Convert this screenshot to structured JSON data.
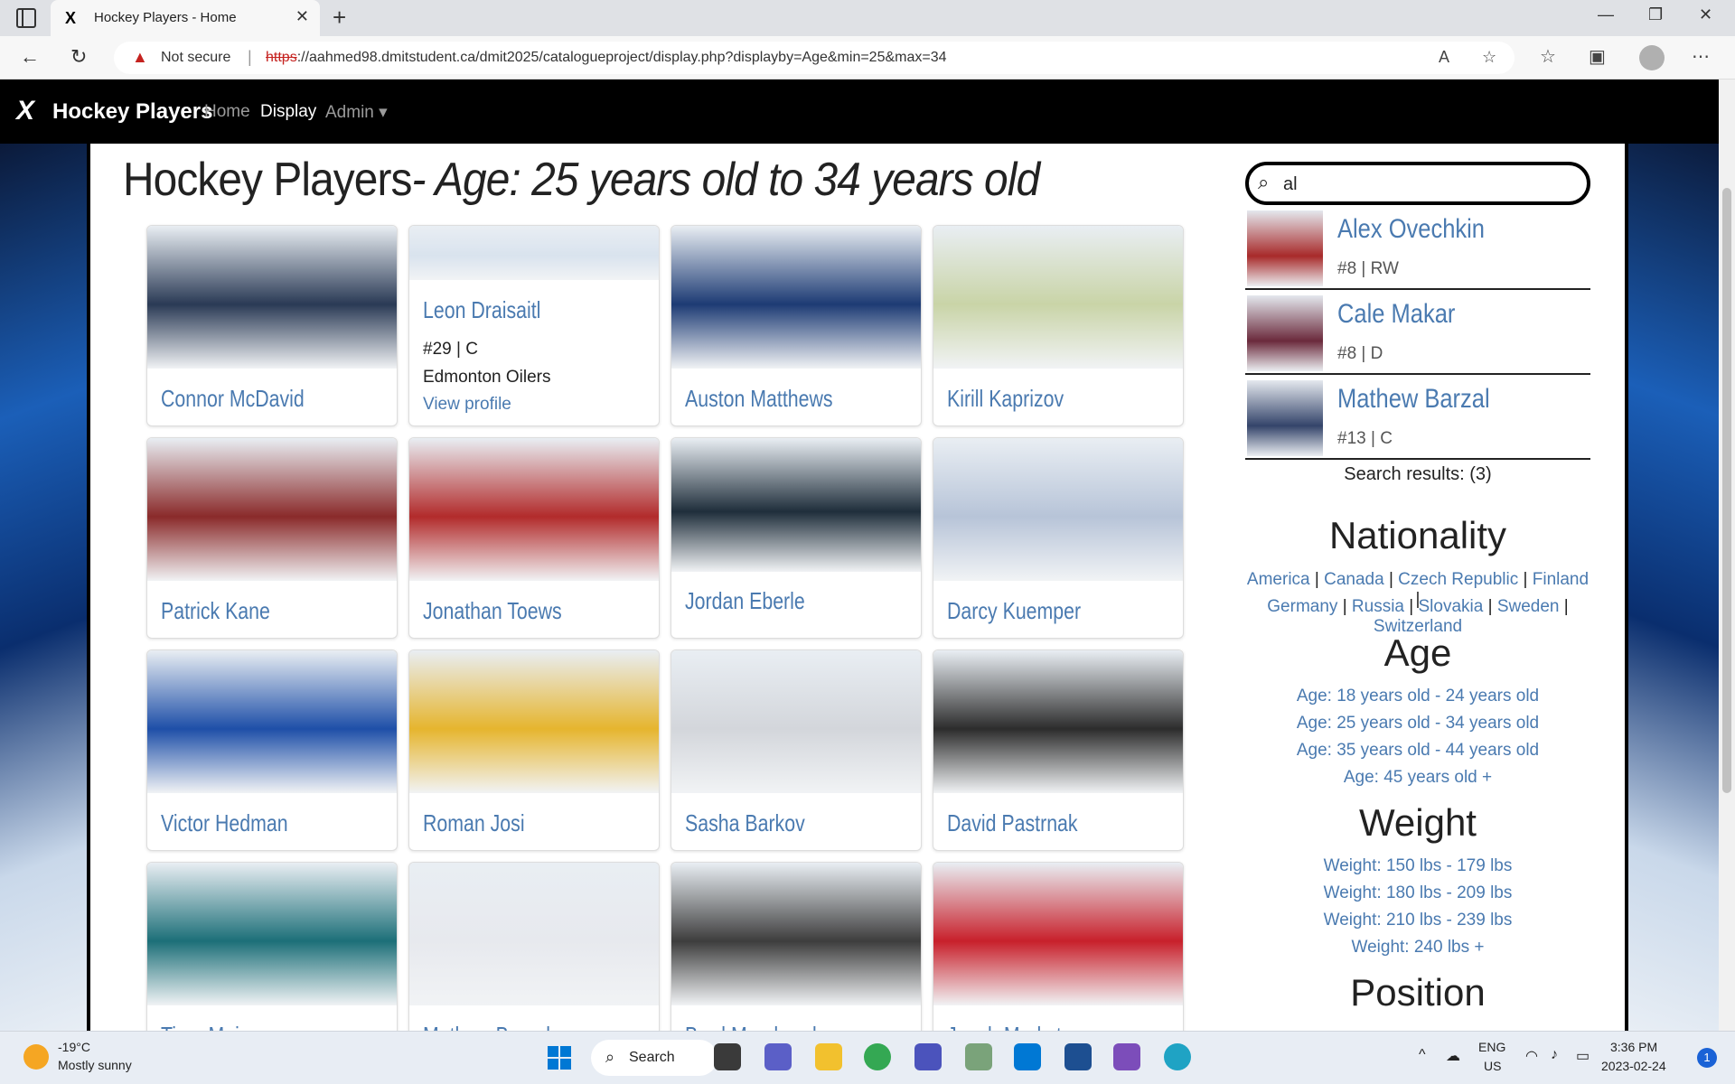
{
  "browser": {
    "tab_title": "Hockey Players - Home",
    "tab_favicon": "X",
    "not_secure": "Not secure",
    "url_scheme": "https",
    "url_rest": "://aahmed98.dmitstudent.ca/dmit2025/catalogueproject/display.php?displayby=Age&min=25&max=34"
  },
  "site": {
    "brand": "Hockey Players",
    "brand_logo": "X",
    "nav": [
      "Home",
      "Display",
      "Admin ▾"
    ]
  },
  "page": {
    "title_main": "Hockey Players",
    "title_sub": "- Age: 25 years old to 34 years old"
  },
  "cards": [
    {
      "name": "Connor McDavid",
      "color": "#2a3a55"
    },
    {
      "name": "Leon Draisaitl",
      "number": "#29 | C",
      "team": "Edmonton Oilers",
      "view": "View profile",
      "color": "#d9e3ee"
    },
    {
      "name": "Auston Matthews",
      "color": "#1d3b74"
    },
    {
      "name": "Kirill Kaprizov",
      "color": "#c9d4a7"
    },
    {
      "name": "Patrick Kane",
      "color": "#8a2a2a"
    },
    {
      "name": "Jonathan Toews",
      "color": "#b22b2b"
    },
    {
      "name": "Jordan Eberle",
      "color": "#1f2e3b"
    },
    {
      "name": "Darcy Kuemper",
      "color": "#b7c4d8"
    },
    {
      "name": "Victor Hedman",
      "color": "#1e4fa8"
    },
    {
      "name": "Roman Josi",
      "color": "#e6b52e"
    },
    {
      "name": "Sasha Barkov",
      "color": "#d3d6db"
    },
    {
      "name": "David Pastrnak",
      "color": "#2c2c2c"
    },
    {
      "name": "Timo Meier",
      "color": "#1c6f78"
    },
    {
      "name": "Mathew Barzal",
      "color": "#e7e9ee"
    },
    {
      "name": "Brad Marchand",
      "color": "#3d3d3d"
    },
    {
      "name": "Jacob Markstrom",
      "color": "#c8202b"
    }
  ],
  "search": {
    "value": "al",
    "results": [
      {
        "name": "Alex Ovechkin",
        "meta": "#8 | RW",
        "color": "#a82a2a"
      },
      {
        "name": "Cale Makar",
        "meta": "#8 | D",
        "color": "#6b2a3c"
      },
      {
        "name": "Mathew Barzal",
        "meta": "#13 | C",
        "color": "#34446a"
      }
    ],
    "count": "Search results: (3)"
  },
  "sidebar": {
    "nationality_head": "Nationality",
    "nationality": [
      "America",
      "Canada",
      "Czech Republic",
      "Finland",
      "Germany",
      "Russia",
      "Slovakia",
      "Sweden",
      "Switzerland"
    ],
    "age_head": "Age",
    "age": [
      "Age: 18 years old - 24 years old",
      "Age: 25 years old - 34 years old",
      "Age: 35 years old - 44 years old",
      "Age: 45 years old +"
    ],
    "weight_head": "Weight",
    "weight": [
      "Weight: 150 lbs - 179 lbs",
      "Weight: 180 lbs - 209 lbs",
      "Weight: 210 lbs - 239 lbs",
      "Weight: 240 lbs +"
    ],
    "position_head": "Position"
  },
  "taskbar": {
    "temp": "-19°C",
    "weather": "Mostly sunny",
    "search": "Search",
    "lang1": "ENG",
    "lang2": "US",
    "time": "3:36 PM",
    "date": "2023-02-24",
    "notif": "1"
  }
}
